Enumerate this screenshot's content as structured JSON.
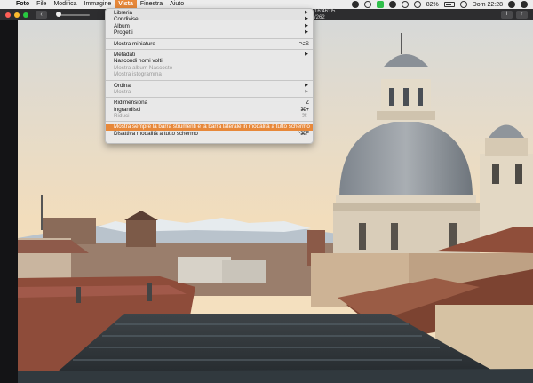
{
  "menubar": {
    "apple_icon": "apple-logo-icon",
    "items": [
      {
        "label": "Foto"
      },
      {
        "label": "File"
      },
      {
        "label": "Modifica"
      },
      {
        "label": "Immagine"
      },
      {
        "label": "Vista"
      },
      {
        "label": "Finestra"
      },
      {
        "label": "Aiuto"
      }
    ],
    "battery": "82%",
    "clock": "Dom 22:28"
  },
  "toolbar": {
    "back_glyph": "‹",
    "title_line1": "16:46:05",
    "title_line2": "/262",
    "info_glyph": "i",
    "share_glyph": "↑"
  },
  "menu": {
    "libreria": "Libreria",
    "condivise": "Condivise",
    "album": "Album",
    "progetti": "Progetti",
    "mostra_miniature": "Mostra miniature",
    "mostra_miniature_sc": "⌥S",
    "metadati": "Metadati",
    "nascondi_volti": "Nascondi nomi volti",
    "mostra_album_nascosto": "Mostra album Nascosto",
    "mostra_istogramma": "Mostra istogramma",
    "ordina": "Ordina",
    "mostra": "Mostra",
    "ridimensiona": "Ridimensiona",
    "ridimensiona_sc": "Z",
    "ingrandisci": "Ingrandisci",
    "ingrandisci_sc": "⌘+",
    "riduci": "Riduci",
    "riduci_sc": "⌘-",
    "mostra_barra": "Mostra sempre la barra strumenti e la barra laterale in modalità a tutto schermo",
    "disattiva": "Disattiva modalità a tutto schermo",
    "disattiva_sc": "^⌘F",
    "arrow": "▶"
  },
  "colors": {
    "menu_highlight": "#e7883a",
    "sky": "#f2ddbc",
    "dome": "#8d9299"
  }
}
